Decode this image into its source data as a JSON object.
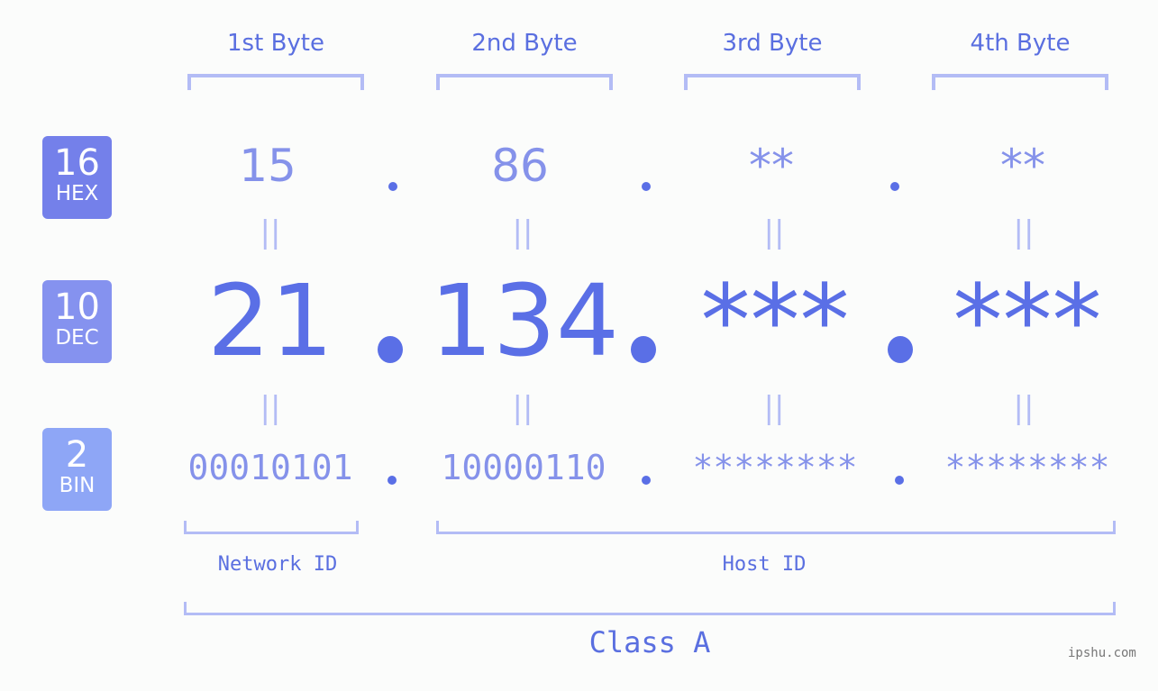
{
  "headers": [
    "1st Byte",
    "2nd Byte",
    "3rd Byte",
    "4th Byte"
  ],
  "badges": [
    {
      "number": "16",
      "label": "HEX",
      "color": "#7480ea"
    },
    {
      "number": "10",
      "label": "DEC",
      "color": "#8592ef"
    },
    {
      "number": "2",
      "label": "BIN",
      "color": "#8ea6f6"
    }
  ],
  "hex": [
    "15",
    "86",
    "**",
    "**"
  ],
  "dec": [
    "21",
    "134",
    "***",
    "***"
  ],
  "bin": [
    "00010101",
    "10000110",
    "********",
    "********"
  ],
  "equals": "=",
  "network_label": "Network ID",
  "host_label": "Host ID",
  "class_label": "Class A",
  "watermark": "ipshu.com",
  "colors": {
    "accent": "#5a6fe6",
    "bracket": "#b3bcf5"
  }
}
